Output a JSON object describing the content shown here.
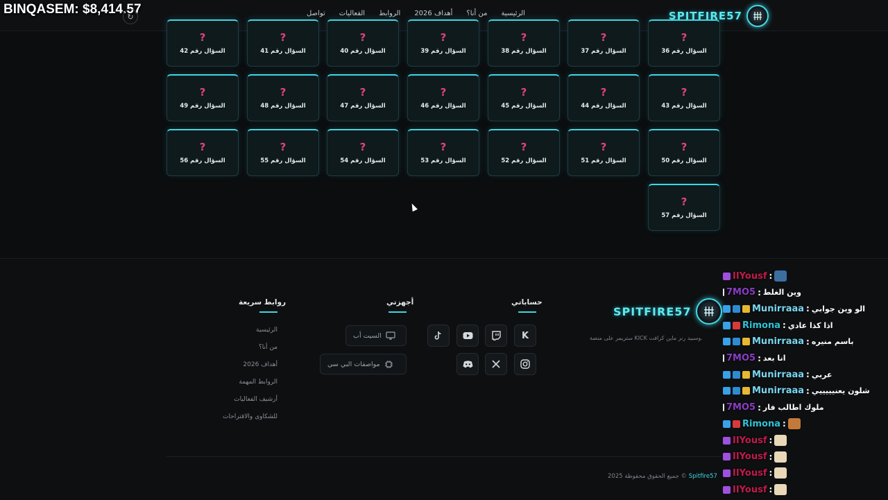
{
  "overlay": {
    "balance": "BINQASEM: $8,414.57"
  },
  "header": {
    "logo": "SPITFIRE57",
    "nav": [
      "الرئيسية",
      "من أنا؟",
      "أهداف 2026",
      "الروابط",
      "الفعاليات",
      "تواصل"
    ]
  },
  "questions": [
    {
      "label": "السؤال رقم 36"
    },
    {
      "label": "السؤال رقم 37"
    },
    {
      "label": "السؤال رقم 38"
    },
    {
      "label": "السؤال رقم 39"
    },
    {
      "label": "السؤال رقم 40"
    },
    {
      "label": "السؤال رقم 41"
    },
    {
      "label": "السؤال رقم 42"
    },
    {
      "label": "السؤال رقم 43"
    },
    {
      "label": "السؤال رقم 44"
    },
    {
      "label": "السؤال رقم 45"
    },
    {
      "label": "السؤال رقم 46"
    },
    {
      "label": "السؤال رقم 47"
    },
    {
      "label": "السؤال رقم 48"
    },
    {
      "label": "السؤال رقم 49"
    },
    {
      "label": "السؤال رقم 50"
    },
    {
      "label": "السؤال رقم 51"
    },
    {
      "label": "السؤال رقم 52"
    },
    {
      "label": "السؤال رقم 53"
    },
    {
      "label": "السؤال رقم 54"
    },
    {
      "label": "السؤال رقم 55"
    },
    {
      "label": "السؤال رقم 56"
    },
    {
      "label": "السؤال رقم 57"
    }
  ],
  "question_mark": "?",
  "footer": {
    "logo": "SPITFIRE57",
    "description": "ستريمر على منصة KICK وسبيد رنر ماين كرافت.",
    "accounts_title": "حساباتي",
    "devices_title": "أجهزتي",
    "devices": [
      {
        "label": "السيت أب",
        "icon": "monitor-icon"
      },
      {
        "label": "مواصفات البي سي",
        "icon": "cpu-icon"
      }
    ],
    "quick_links_title": "روابط سريعة",
    "quick_links": [
      "الرئيسية",
      "من أنا؟",
      "أهداف 2026",
      "الروابط المهمة",
      "أرشيف الفعاليات",
      "للشكاوى والاقتراحات"
    ],
    "social": [
      "kick-icon",
      "twitch-icon",
      "youtube-icon",
      "tiktok-icon",
      "instagram-icon",
      "x-icon",
      "discord-icon"
    ],
    "copyright_year": "2025 ©",
    "copyright_brand": "Spitfire57",
    "copyright_text": "جميع الحقوق محفوظة"
  },
  "chat": [
    {
      "user": "IIYousf",
      "color": "#c21a4a",
      "badges": [
        "purple"
      ],
      "message": "",
      "emote": "#3b6fa0"
    },
    {
      "user": "7MO5",
      "color": "#8a3cc4",
      "badges": [
        "white"
      ],
      "message": "وين الغلط",
      "emote": ""
    },
    {
      "user": "Munirraaa",
      "color": "#7ad6f0",
      "badges": [
        "blue",
        "blue2",
        "gold"
      ],
      "message": "الو وين جوابي",
      "emote": ""
    },
    {
      "user": "Rimona",
      "color": "#2fc3d8",
      "badges": [
        "blue",
        "red"
      ],
      "message": "اذا كذا عادي",
      "emote": ""
    },
    {
      "user": "Munirraaa",
      "color": "#7ad6f0",
      "badges": [
        "blue",
        "blue2",
        "gold"
      ],
      "message": "باسم منيره",
      "emote": ""
    },
    {
      "user": "7MO5",
      "color": "#8a3cc4",
      "badges": [
        "white"
      ],
      "message": "انا بعد",
      "emote": ""
    },
    {
      "user": "Munirraaa",
      "color": "#7ad6f0",
      "badges": [
        "blue",
        "blue2",
        "gold"
      ],
      "message": "عربي",
      "emote": ""
    },
    {
      "user": "Munirraaa",
      "color": "#7ad6f0",
      "badges": [
        "blue",
        "blue2",
        "gold"
      ],
      "message": "شلون يعنيييييي",
      "emote": ""
    },
    {
      "user": "7MO5",
      "color": "#8a3cc4",
      "badges": [
        "white"
      ],
      "message": "ملوك اطالب فار",
      "emote": ""
    },
    {
      "user": "Rimona",
      "color": "#2fc3d8",
      "badges": [
        "blue",
        "red"
      ],
      "message": "",
      "emote": "#c27a3a"
    },
    {
      "user": "IIYousf",
      "color": "#c21a4a",
      "badges": [
        "purple"
      ],
      "message": "",
      "emote": "#e8d8b8"
    },
    {
      "user": "IIYousf",
      "color": "#c21a4a",
      "badges": [
        "purple"
      ],
      "message": "",
      "emote": "#e8d8b8"
    },
    {
      "user": "IIYousf",
      "color": "#c21a4a",
      "badges": [
        "purple"
      ],
      "message": "",
      "emote": "#e8d8b8"
    },
    {
      "user": "IIYousf",
      "color": "#c21a4a",
      "badges": [
        "purple"
      ],
      "message": "",
      "emote": "#e8d8b8"
    }
  ]
}
